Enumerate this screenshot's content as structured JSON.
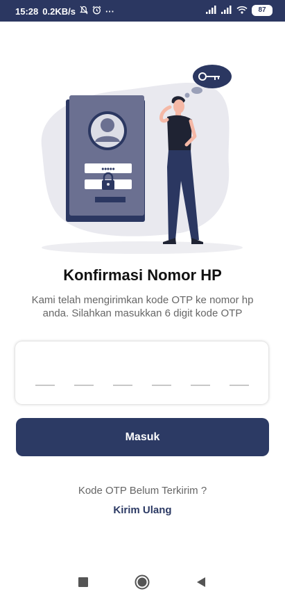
{
  "status_bar": {
    "time": "15:28",
    "network_speed": "0.2KB/s",
    "more": "···",
    "battery": "87",
    "icons": [
      "mute-icon",
      "alarm-icon",
      "signal-icon",
      "signal-icon",
      "wifi-icon",
      "battery-icon"
    ]
  },
  "illustration": {
    "icons": [
      "id-card-icon",
      "key-icon",
      "lock-icon",
      "person-thinking-icon"
    ],
    "password_mask": "•••••"
  },
  "title": "Konfirmasi Nomor HP",
  "description": "Kami telah mengirimkan kode OTP ke nomor hp anda. Silahkan masukkan 6 digit kode OTP",
  "otp": {
    "digits": 6,
    "values": [
      "",
      "",
      "",
      "",
      "",
      ""
    ]
  },
  "submit_button": {
    "label": "Masuk"
  },
  "resend": {
    "question": "Kode OTP Belum Terkirim ?",
    "link": "Kirim Ulang"
  },
  "nav_bar": {
    "icons": [
      "recent-apps-icon",
      "home-icon",
      "back-icon"
    ]
  },
  "colors": {
    "primary": "#2c3a64",
    "status_bar": "#2b3761",
    "blob": "#e9e9ef"
  }
}
